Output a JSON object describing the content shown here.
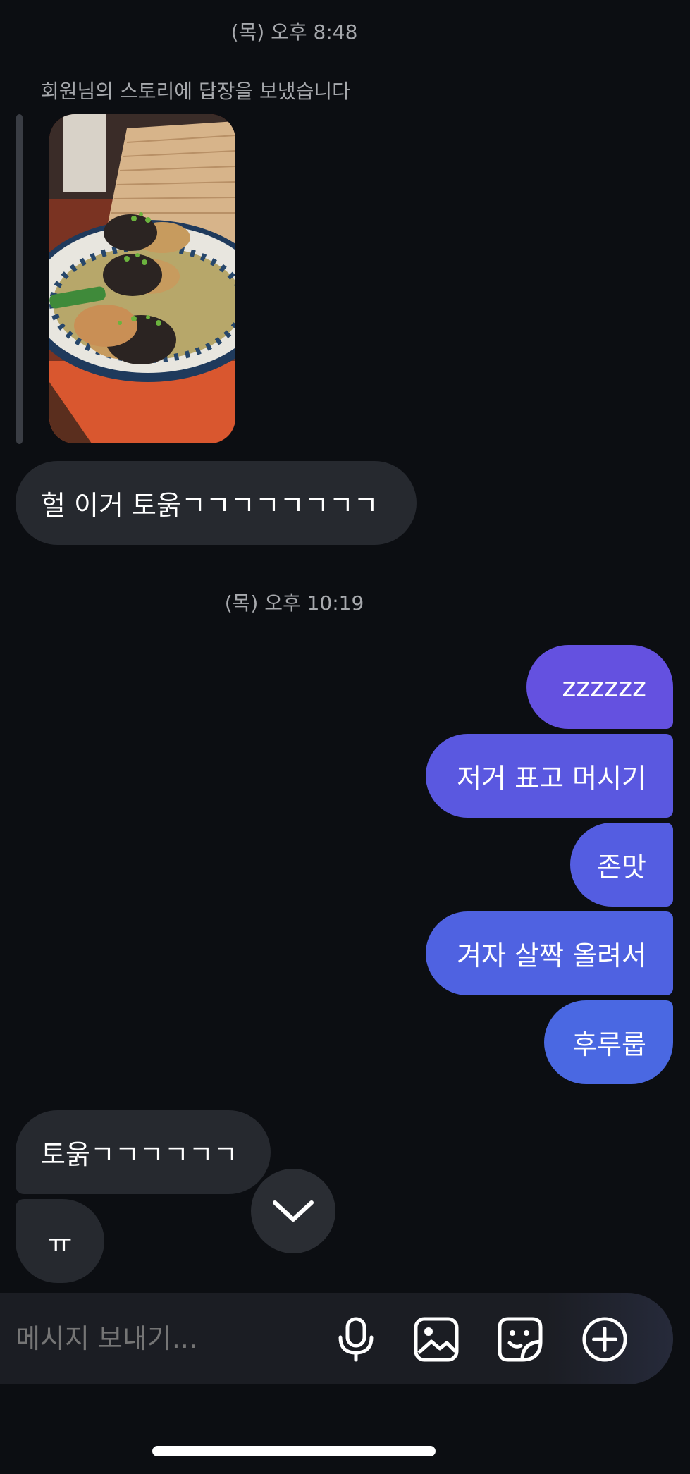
{
  "conversation": {
    "timestamp_1": "(목) 오후 8:48",
    "story_reply_note": "회원님의 스토리에 답장을 보냈습니다",
    "msg_in_1": "헐 이거 토욹ㄱㄱㄱㄱㄱㄱㄱㄱ",
    "timestamp_2": "(목) 오후 10:19",
    "msg_out": [
      "zzzzzz",
      "저거 표고 머시기",
      "존맛",
      "겨자 살짝 올려서",
      "후루룹"
    ],
    "msg_in_2": "토욹ㄱㄱㄱㄱㄱㄱ",
    "msg_in_3": "ㅠ"
  },
  "composer": {
    "placeholder": "메시지 보내기..."
  },
  "icons": {
    "scroll_down": "chevron-down-icon",
    "mic": "microphone-icon",
    "gallery": "image-icon",
    "sticker": "sticker-icon",
    "add": "plus-circle-icon"
  },
  "colors": {
    "background": "#0c0e12",
    "incoming_bubble": "#26292f",
    "outgoing_gradient_top": "#6451e0",
    "outgoing_gradient_bottom": "#4a68e2"
  }
}
